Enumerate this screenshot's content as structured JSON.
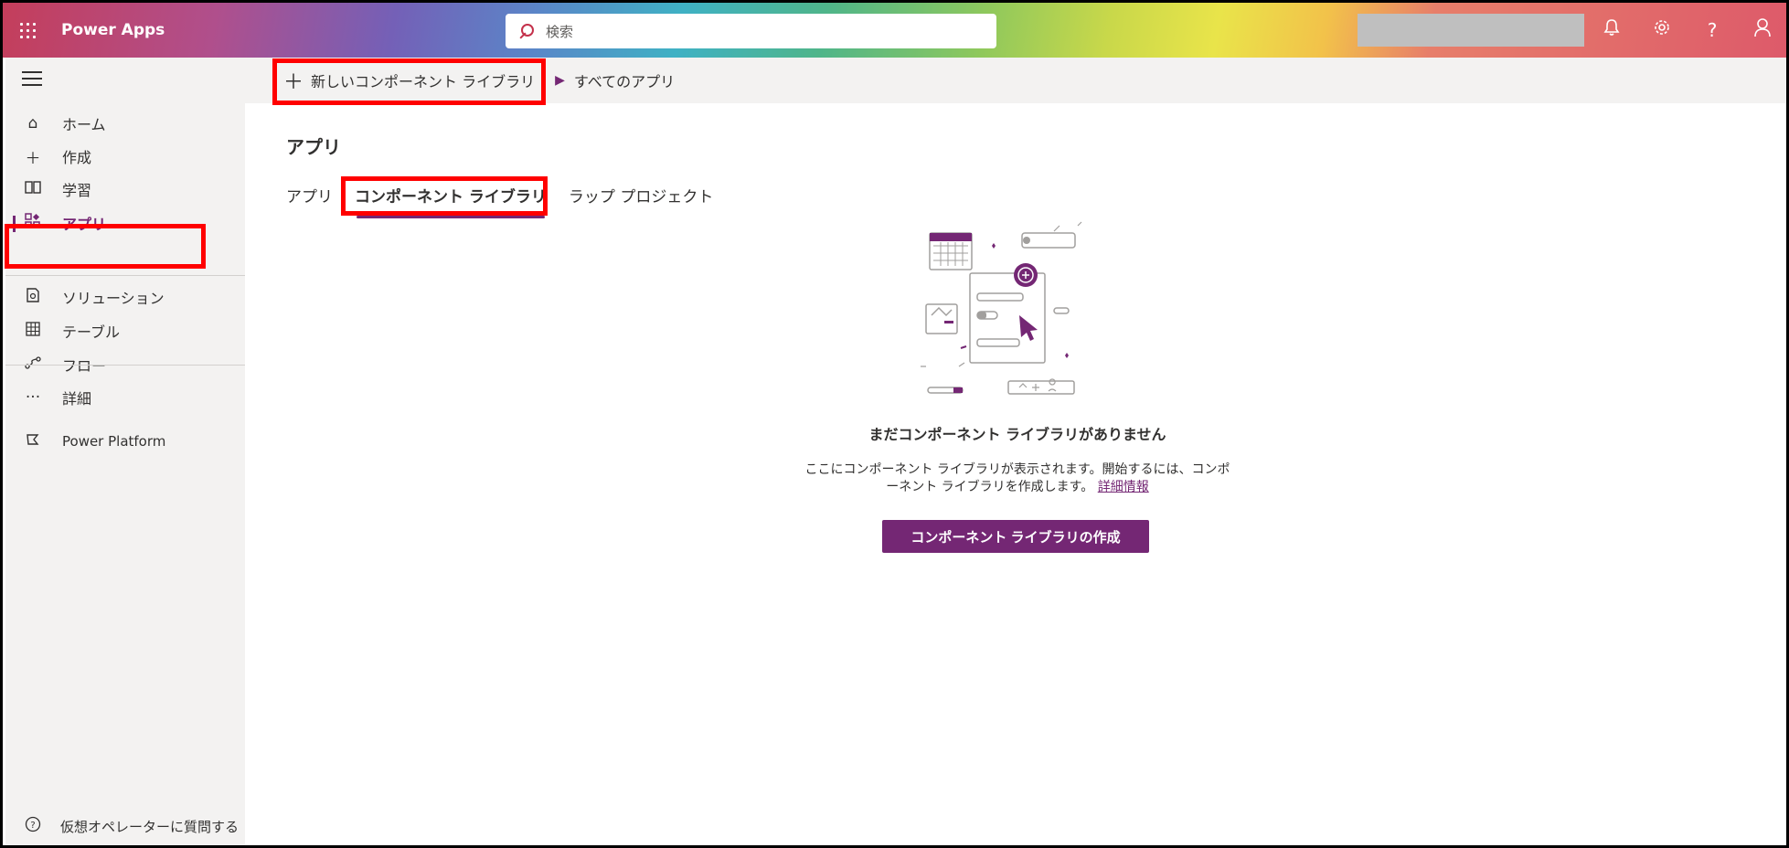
{
  "header": {
    "app_title": "Power Apps",
    "search_placeholder": "検索",
    "icons": [
      "waffle-icon",
      "bell-icon",
      "gear-icon",
      "help-icon",
      "account-icon"
    ],
    "help_glyph": "?"
  },
  "sidebar": {
    "items": [
      {
        "label": "ホーム",
        "icon": "home-icon"
      },
      {
        "label": "作成",
        "icon": "plus-icon"
      },
      {
        "label": "学習",
        "icon": "book-icon"
      },
      {
        "label": "アプリ",
        "icon": "apps-icon",
        "active": true
      },
      {
        "label": "ソリューション",
        "icon": "solution-icon"
      },
      {
        "label": "テーブル",
        "icon": "table-icon"
      },
      {
        "label": "フロー",
        "icon": "flow-icon"
      },
      {
        "label": "詳細",
        "icon": "more-icon"
      },
      {
        "label": "Power Platform",
        "icon": "power-platform-icon"
      }
    ],
    "virtual_agent_label": "仮想オペレーターに質問する"
  },
  "command_bar": {
    "new_component_library": "新しいコンポーネント ライブラリ",
    "all_apps": "すべてのアプリ"
  },
  "main": {
    "title": "アプリ",
    "tabs": [
      {
        "label": "アプリ"
      },
      {
        "label": "コンポーネント ライブラリ",
        "selected": true
      },
      {
        "label": "ラップ プロジェクト"
      }
    ],
    "empty_state": {
      "title": "まだコンポーネント ライブラリがありません",
      "description_line1": "ここにコンポーネント ライブラリが表示されます。開始するには、コンポ",
      "description_line2": "ーネント ライブラリを作成します。",
      "learn_more": "詳細情報",
      "create_button": "コンポーネント ライブラリの作成"
    }
  },
  "colors": {
    "accent": "#742774",
    "highlight": "#ff0000",
    "sidebar_bg": "#f3f2f1"
  }
}
